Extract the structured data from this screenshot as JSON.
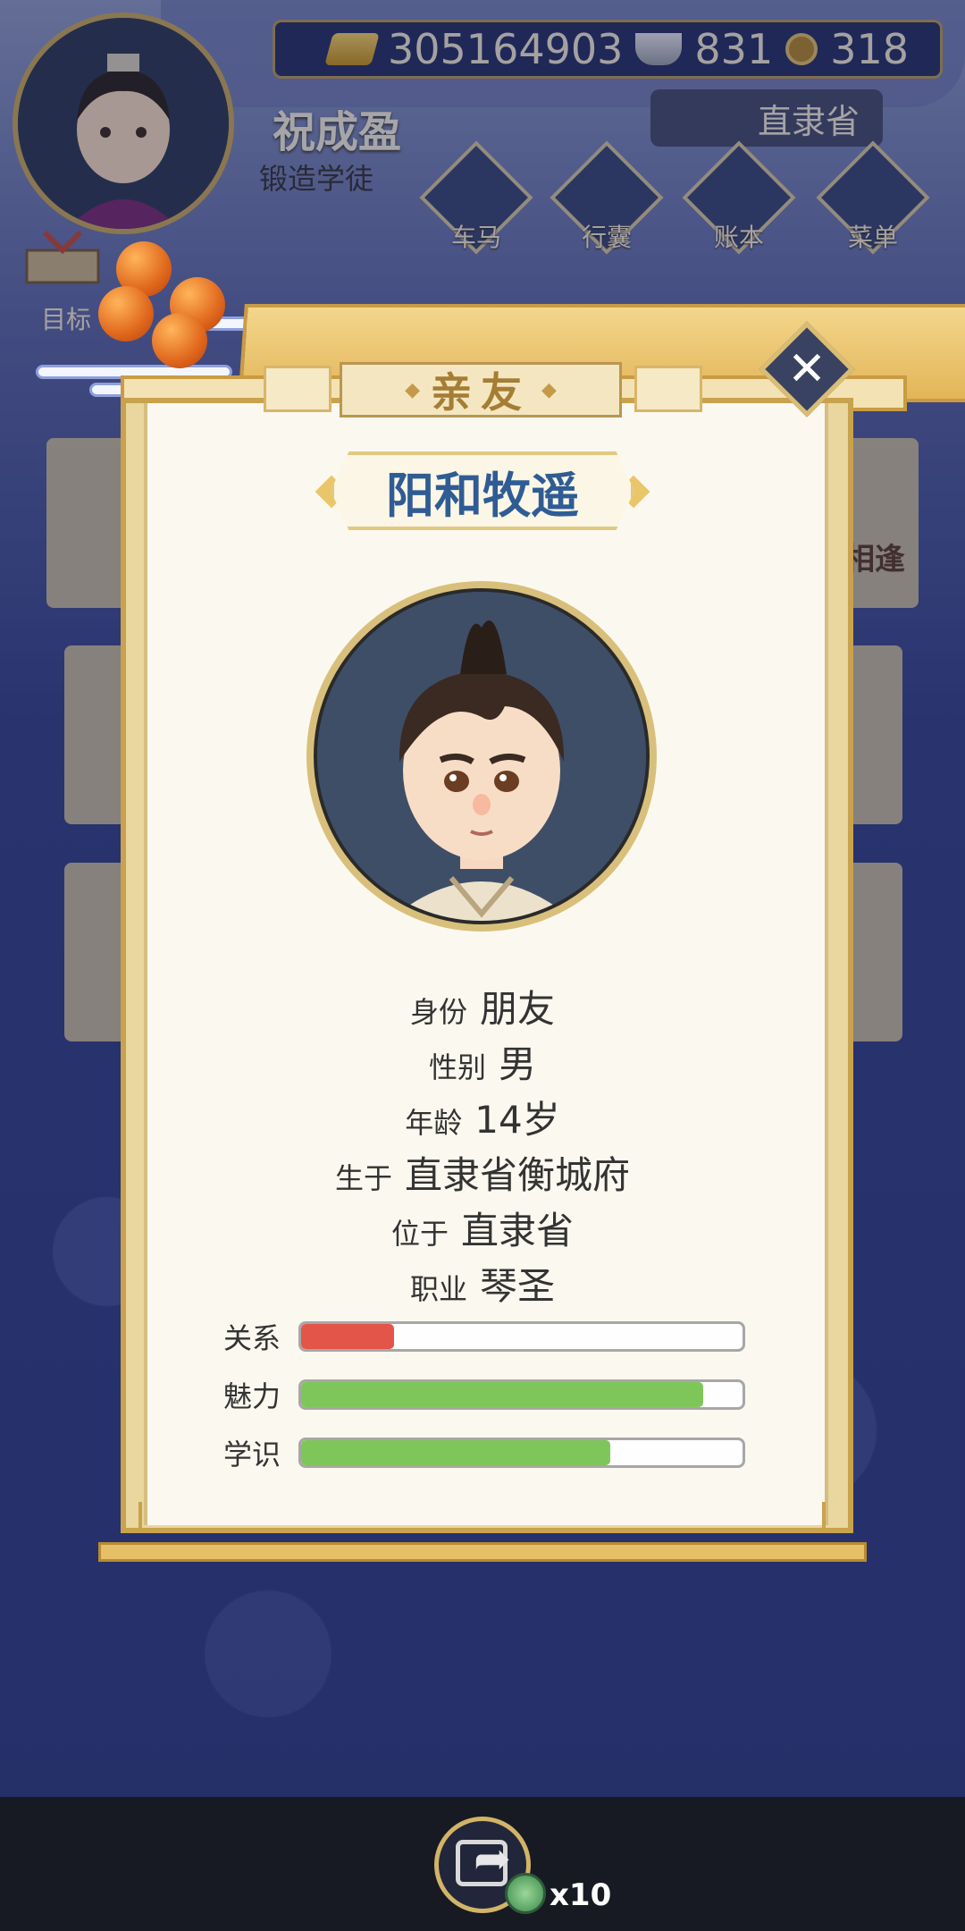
{
  "header": {
    "currency": {
      "ingots": "305164903",
      "silver": "831",
      "coins": "318"
    },
    "player": {
      "name": "祝成盈",
      "title": "锻造学徒"
    },
    "location": "直隶省",
    "nav": [
      {
        "label": "车马",
        "icon": "carriage-icon"
      },
      {
        "label": "行囊",
        "icon": "bag-icon"
      },
      {
        "label": "账本",
        "icon": "ledger-icon"
      },
      {
        "label": "菜单",
        "icon": "menu-icon"
      }
    ],
    "goal_label": "目标"
  },
  "background": {
    "side_label": "相逢"
  },
  "modal": {
    "title": "亲友",
    "close_icon": "close-icon",
    "character_name": "阳和牧遥",
    "info": [
      {
        "label": "身份",
        "value": "朋友"
      },
      {
        "label": "性别",
        "value": "男"
      },
      {
        "label": "年龄",
        "value": "14岁"
      },
      {
        "label": "生于",
        "value": "直隶省衡城府"
      },
      {
        "label": "位于",
        "value": "直隶省"
      },
      {
        "label": "职业",
        "value": "琴圣"
      }
    ],
    "stats": [
      {
        "label": "关系",
        "fill": 0.21,
        "color": "#e25548"
      },
      {
        "label": "魅力",
        "fill": 0.91,
        "color": "#7ec65a"
      },
      {
        "label": "学识",
        "fill": 0.7,
        "color": "#7ec65a"
      }
    ]
  },
  "footer": {
    "share_count": "x10"
  }
}
